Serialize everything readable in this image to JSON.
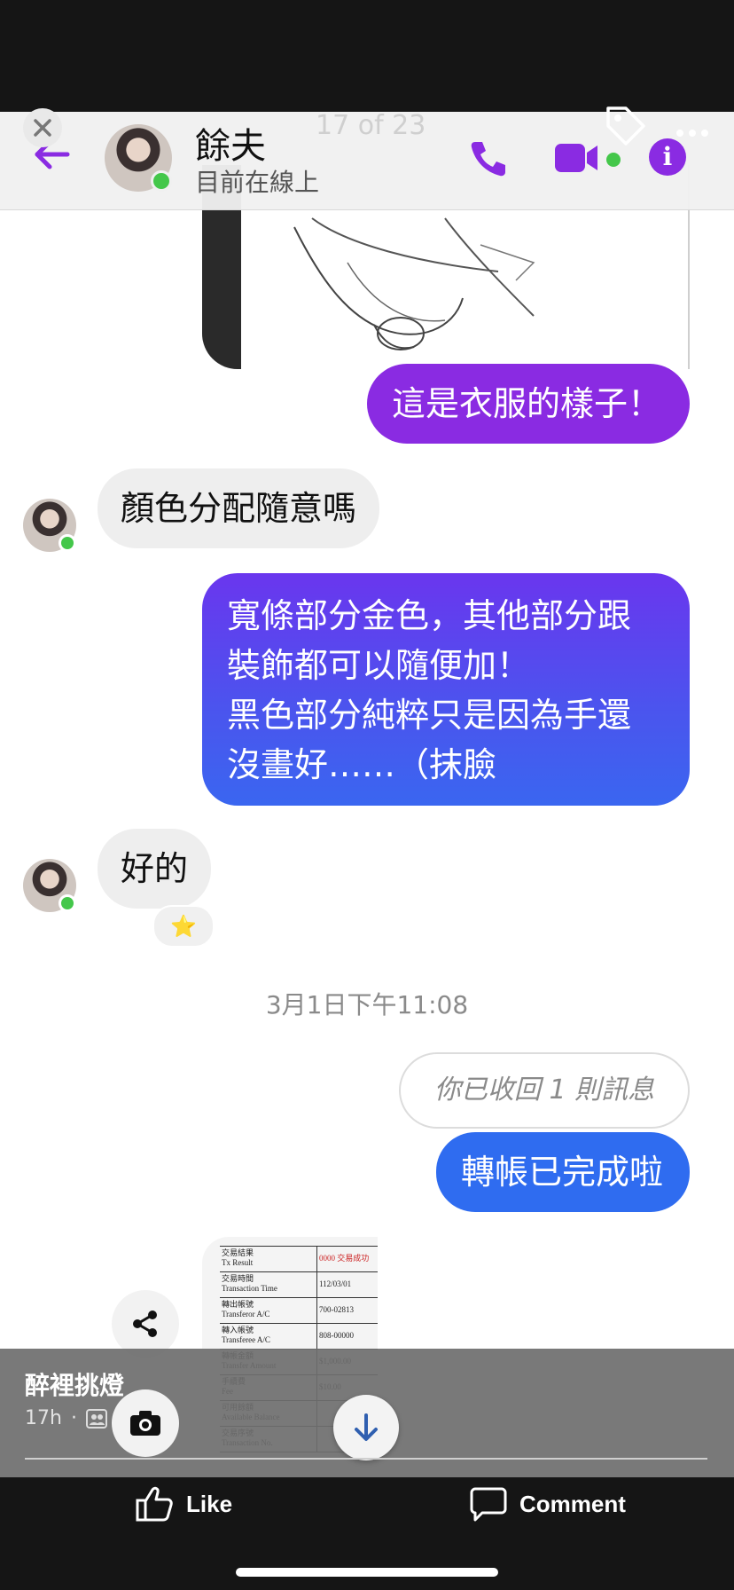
{
  "viewer": {
    "counter": "17 of 23"
  },
  "header": {
    "contact_name": "餘夫",
    "status": "目前在線上"
  },
  "messages": {
    "m1": "這是衣服的樣子！",
    "m2": "顏色分配隨意嗎",
    "m3_lines": [
      "寬條部分金色，其他部分跟",
      "裝飾都可以隨便加！",
      "黑色部分純粹只是因為手還",
      "沒畫好……（抹臉"
    ],
    "m4": "好的",
    "m4_reaction": "⭐",
    "timestamp": "3月1日下午11:08",
    "m5_unsent": "你已收回 1 則訊息",
    "m6": "轉帳已完成啦"
  },
  "receipt": {
    "rows": [
      {
        "zh": "交易結果",
        "en": "Tx Result",
        "val": "0000 交易成功"
      },
      {
        "zh": "交易時間",
        "en": "Transaction Time",
        "val": "112/03/01"
      },
      {
        "zh": "轉出帳號",
        "en": "Transferor A/C",
        "val": "700-02813"
      },
      {
        "zh": "轉入帳號",
        "en": "Transferee A/C",
        "val": "808-00000"
      },
      {
        "zh": "轉帳金額",
        "en": "Transfer Amount",
        "val": "$1,000.00"
      },
      {
        "zh": "手續費",
        "en": "Fee",
        "val": "$10.00"
      },
      {
        "zh": "可用餘額",
        "en": "Available Balance",
        "val": ""
      },
      {
        "zh": "交易序號",
        "en": "Transaction No.",
        "val": ""
      }
    ]
  },
  "post": {
    "author": "醉裡挑燈",
    "time": "17h",
    "dot": "·"
  },
  "actions": {
    "like": "Like",
    "comment": "Comment"
  },
  "colors": {
    "accent_purple": "#8a2be2",
    "bubble_gradient_top": "#7a2cf0",
    "bubble_gradient_blue": "#3366f0",
    "online_green": "#44c74a"
  }
}
